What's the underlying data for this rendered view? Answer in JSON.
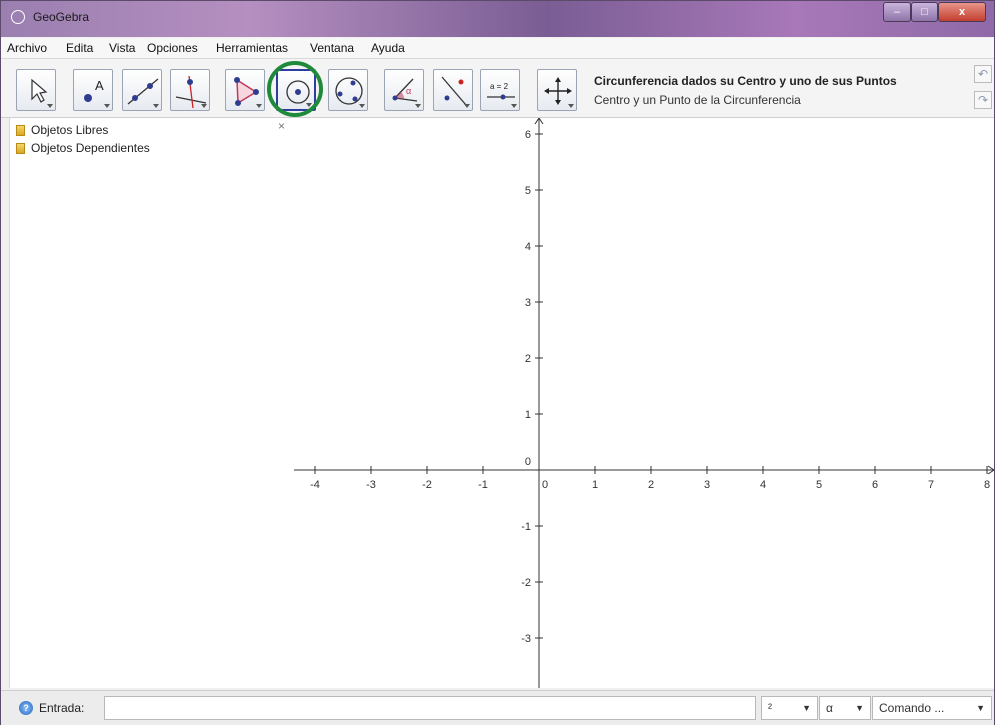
{
  "window": {
    "title": "GeoGebra",
    "close_glyph": "x"
  },
  "menu": [
    "Archivo",
    "Edita",
    "Vista",
    "Opciones",
    "Herramientas",
    "Ventana",
    "Ayuda"
  ],
  "toolbar": {
    "tools": [
      {
        "icon": "move-arrow-icon"
      },
      {
        "icon": "new-point-icon",
        "label": "A"
      },
      {
        "icon": "line-through-points-icon"
      },
      {
        "icon": "perpendicular-line-icon"
      },
      {
        "icon": "polygon-icon"
      },
      {
        "icon": "circle-center-point-icon",
        "selected": true
      },
      {
        "icon": "circle-three-points-icon"
      },
      {
        "icon": "angle-icon",
        "label": "α"
      },
      {
        "icon": "reflect-about-line-icon"
      },
      {
        "icon": "slider-icon",
        "label": "a = 2"
      },
      {
        "icon": "move-graphics-view-icon"
      }
    ],
    "active_tool_title": "Circunferencia dados su Centro y uno de sus Puntos",
    "active_tool_help": "Centro y un Punto de la Circunferencia",
    "highlight_color": "#1f8a3a",
    "selected_border_color": "#2d3f9e"
  },
  "algebra": {
    "close_glyph": "×",
    "folders": [
      "Objetos Libres",
      "Objetos Dependientes"
    ]
  },
  "graphics": {
    "x_ticks": [
      "-4",
      "-3",
      "-2",
      "-1",
      "0",
      "1",
      "2",
      "3",
      "4",
      "5",
      "6",
      "7",
      "8"
    ],
    "y_ticks": [
      "6",
      "5",
      "4",
      "3",
      "2",
      "1",
      "-1",
      "-2",
      "-3"
    ],
    "y_origin_label": "0"
  },
  "input": {
    "label": "Entrada:",
    "value": "",
    "superscript_dropdown": "²",
    "greek_dropdown": "α",
    "command_dropdown": "Comando ..."
  }
}
